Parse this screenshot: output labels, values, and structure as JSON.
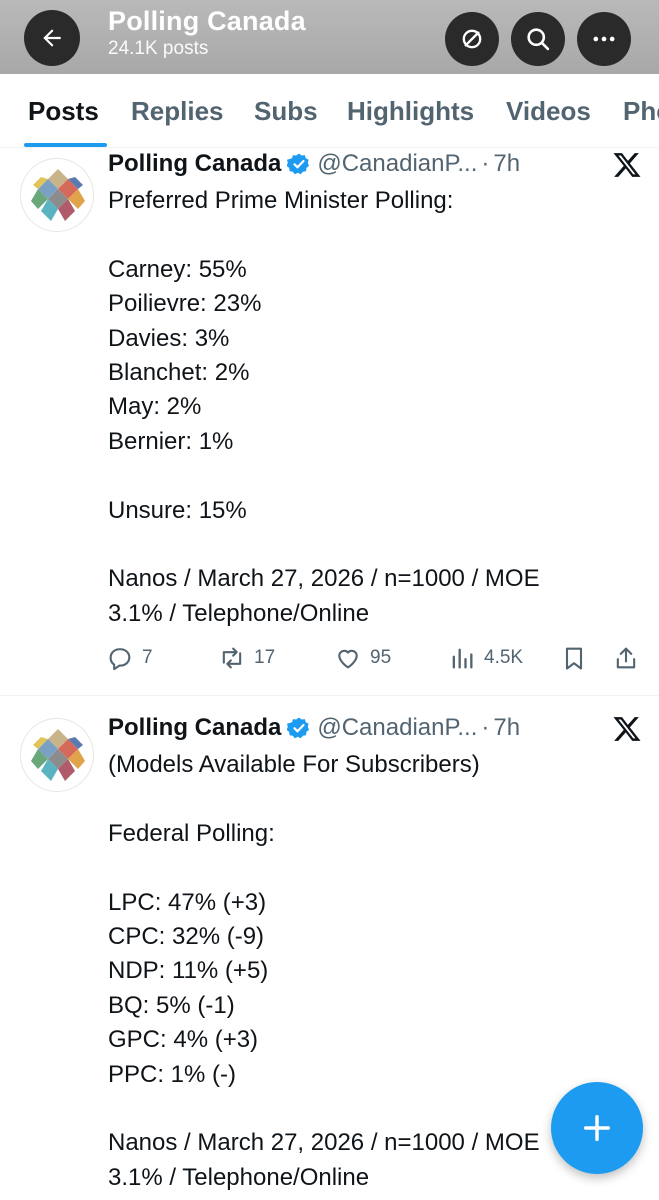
{
  "header": {
    "title": "Polling Canada",
    "subtitle": "24.1K posts"
  },
  "tabs": [
    {
      "label": "Posts"
    },
    {
      "label": "Replies"
    },
    {
      "label": "Subs"
    },
    {
      "label": "Highlights"
    },
    {
      "label": "Videos"
    },
    {
      "label": "Pho"
    }
  ],
  "posts": [
    {
      "author": "Polling Canada",
      "handle": "@CanadianP...",
      "dot": "·",
      "time": "7h",
      "text": "Preferred Prime Minister Polling:\n\nCarney: 55%\nPoilievre: 23%\nDavies: 3%\nBlanchet: 2%\nMay: 2%\nBernier: 1%\n\nUnsure: 15%\n\nNanos / March 27, 2026 / n=1000 / MOE\n3.1% / Telephone/Online",
      "replies": "7",
      "reposts": "17",
      "likes": "95",
      "views": "4.5K"
    },
    {
      "author": "Polling Canada",
      "handle": "@CanadianP...",
      "dot": "·",
      "time": "7h",
      "text": "(Models Available For Subscribers)\n\nFederal Polling:\n\nLPC: 47% (+3)\nCPC: 32% (-9)\nNDP: 11% (+5)\nBQ: 5% (-1)\nGPC: 4% (+3)\nPPC: 1% (-)\n\nNanos / March 27, 2026 / n=1000 / MOE\n3.1% / Telephone/Online"
    }
  ],
  "colors": {
    "accent": "#1d9bf0",
    "muted": "#536471",
    "text": "#0f1419"
  },
  "icons": {
    "back": "arrow-left-icon",
    "subscribe": "slashed-circle-icon",
    "search": "search-icon",
    "more": "more-icon",
    "verified": "verified-badge-icon",
    "x": "x-logo-icon",
    "compose": "plus-icon"
  }
}
